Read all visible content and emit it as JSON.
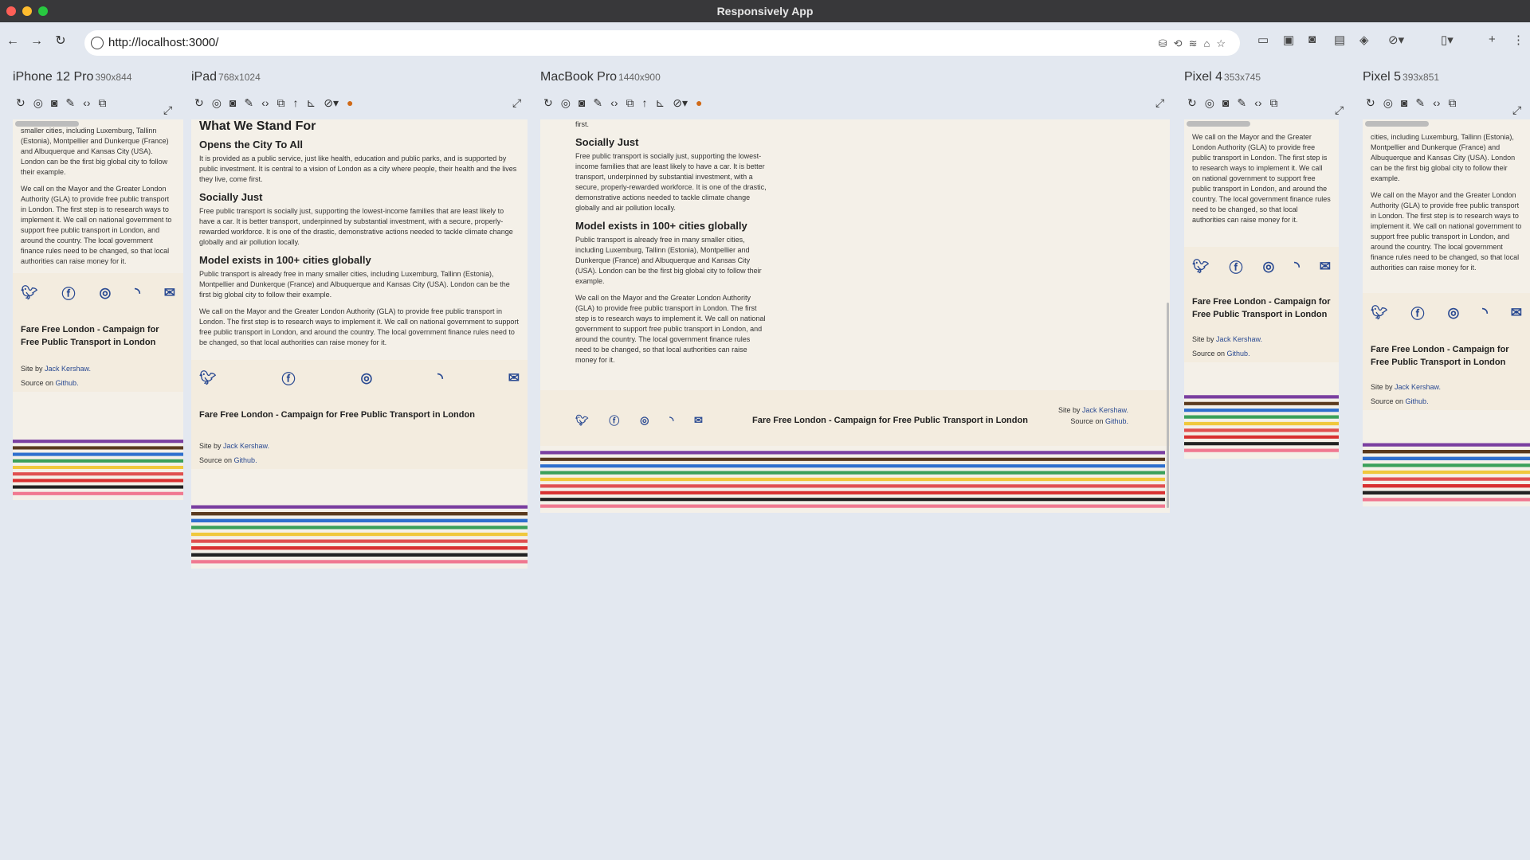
{
  "window": {
    "title": "Responsively App"
  },
  "address": {
    "url": "http://localhost:3000/"
  },
  "devices": [
    {
      "name": "iPhone 12 Pro",
      "dims": "390x844"
    },
    {
      "name": "iPad",
      "dims": "768x1024"
    },
    {
      "name": "MacBook Pro",
      "dims": "1440x900"
    },
    {
      "name": "Pixel 4",
      "dims": "353x745"
    },
    {
      "name": "Pixel 5",
      "dims": "393x851"
    }
  ],
  "page": {
    "heading": "What We Stand For",
    "s1_title": "Opens the City To All",
    "s1_text": "It is provided as a public service, just like health, education and public parks, and is supported by public investment. It is central to a vision of London as a city where people, their health and the lives they live, come first.",
    "s2_title": "Socially Just",
    "s2_text": "Free public transport is socially just, supporting the lowest-income families that are least likely to have a car. It is better transport, underpinned by substantial investment, with a secure, properly-rewarded workforce. It is one of the drastic, demonstrative actions needed to tackle climate change globally and air pollution locally.",
    "s3_title": "Model exists in 100+ cities globally",
    "s3_text": "Public transport is already free in many smaller cities, including Luxemburg, Tallinn (Estonia), Montpellier and Dunkerque (France) and Albuquerque and Kansas City (USA). London can be the first big global city to follow their example.",
    "call_text": "We call on the Mayor and the Greater London Authority (GLA) to provide free public transport in London. The first step is to research ways to implement it. We call on national government to support free public transport in London, and around the country. The local government finance rules need to be changed, so that local authorities can raise money for it.",
    "iphone_top": "smaller cities, including Luxemburg, Tallinn (Estonia), Montpellier and Dunkerque (France) and Albuquerque and Kansas City (USA). London can be the first big global city to follow their example.",
    "pixel5_top": "cities, including Luxemburg, Tallinn (Estonia), Montpellier and Dunkerque (France) and Albuquerque and Kansas City (USA). London can be the first big global city to follow their example.",
    "mac_top": "first.",
    "footer_title": "Fare Free London - Campaign for Free Public Transport in London",
    "site_by": "Site by",
    "author": "Jack Kershaw.",
    "source_on": "Source on",
    "github": "Github."
  },
  "icons": {
    "social": [
      "twitter",
      "facebook",
      "instagram",
      "rss",
      "email"
    ],
    "device_tools": [
      "reload",
      "screenshot",
      "camera",
      "color-picker",
      "code",
      "rotate",
      "up",
      "ruler",
      "hide",
      "color"
    ]
  },
  "colors": {
    "page_bg": "#f4f0e8",
    "link": "#2a4a92",
    "app_bg": "#e3e8f0",
    "lines": [
      "#7a3fa0",
      "#5a3a1e",
      "#2e6fce",
      "#3aa05a",
      "#f0c83c",
      "#e05050",
      "#d83030",
      "#222222",
      "#f07890"
    ]
  }
}
